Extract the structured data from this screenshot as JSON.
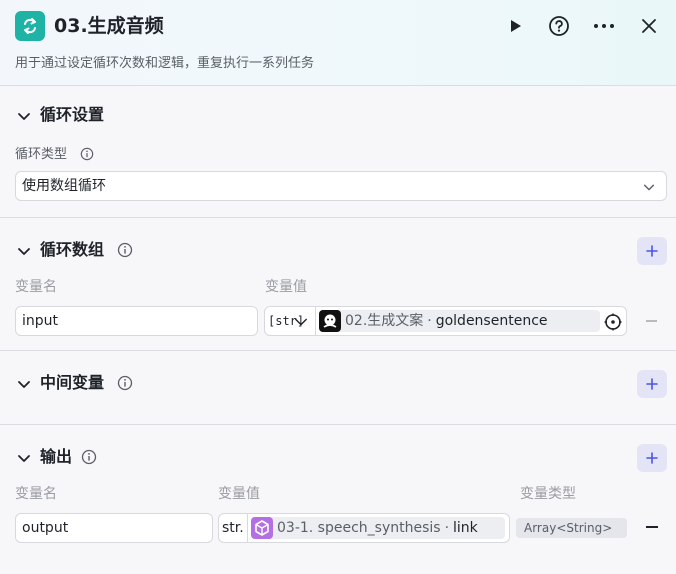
{
  "header": {
    "title": "03.生成音频",
    "description": "用于通过设定循环次数和逻辑，重复执行一系列任务"
  },
  "loop_settings": {
    "title": "循环设置",
    "type_label": "循环类型",
    "type_value": "使用数组循环"
  },
  "loop_array": {
    "title": "循环数组",
    "col_name": "变量名",
    "col_value": "变量值",
    "row": {
      "name": "input",
      "type_tag": "[str]",
      "ref_node": "02.生成文案",
      "separator": "·",
      "ref_field": "goldensentence"
    }
  },
  "intermediate": {
    "title": "中间变量"
  },
  "output": {
    "title": "输出",
    "col_name": "变量名",
    "col_value": "变量值",
    "col_type": "变量类型",
    "row": {
      "name": "output",
      "type_tag": "str.",
      "ref_node": "03-1. speech_synthesis",
      "separator": "·",
      "ref_field": "link",
      "var_type": "Array<String>"
    }
  },
  "icons": {
    "node": "loop-icon",
    "run": "play-icon",
    "help": "help-circle-icon",
    "more": "more-icon",
    "close": "close-icon"
  },
  "colors": {
    "accent": "#1fb3a6",
    "plus_bg": "#e4e4f7",
    "plus_fg": "#4d53e8",
    "ref_plugin": "#b46fe3"
  }
}
